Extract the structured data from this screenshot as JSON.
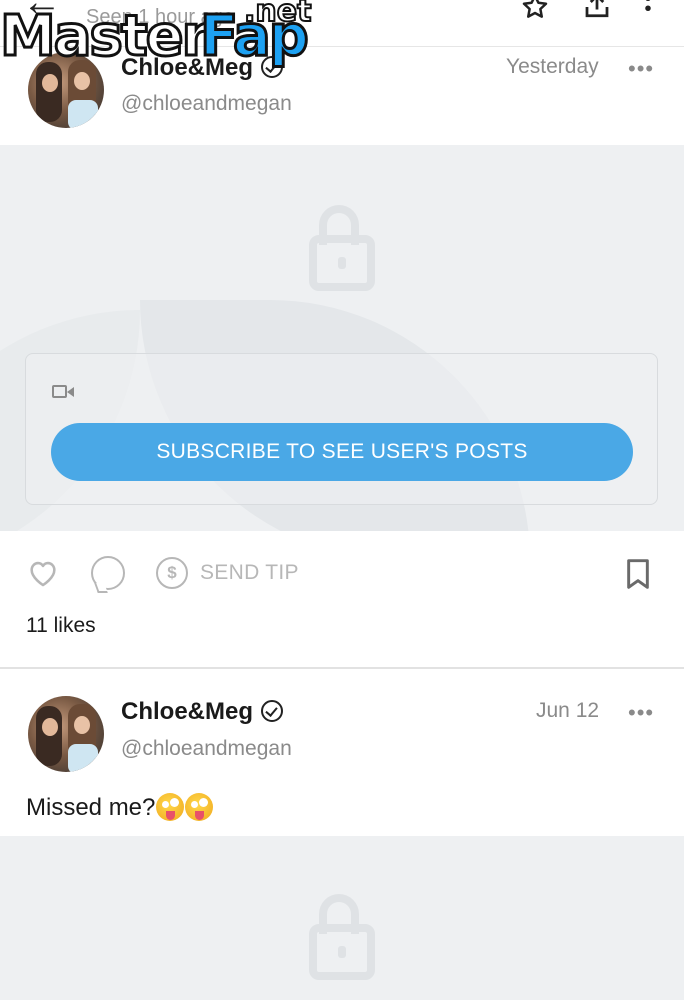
{
  "header": {
    "seen_text": "Seen 1 hour ago",
    "back_icon": "back-arrow-icon",
    "icons": [
      "star-icon",
      "share-icon",
      "more-vertical-icon"
    ]
  },
  "watermark": {
    "part1": "Master",
    "part2": "Fap",
    "part3": ".net"
  },
  "posts": [
    {
      "author": "Chloe&Meg",
      "handle": "@chloeandmegan",
      "date": "Yesterday",
      "menu": "•••",
      "locked": true,
      "subscribe_label": "SUBSCRIBE TO SEE USER'S POSTS",
      "send_tip_label": "SEND TIP",
      "likes": "11 likes"
    },
    {
      "author": "Chloe&Meg",
      "handle": "@chloeandmegan",
      "date": "Jun 12",
      "menu": "•••",
      "caption": "Missed me?",
      "caption_emoji": "zany-face-emoji",
      "locked": true
    }
  ],
  "colors": {
    "accent": "#4aa8e6",
    "muted": "#8a8a8a",
    "locked_bg": "#eef0f2"
  }
}
